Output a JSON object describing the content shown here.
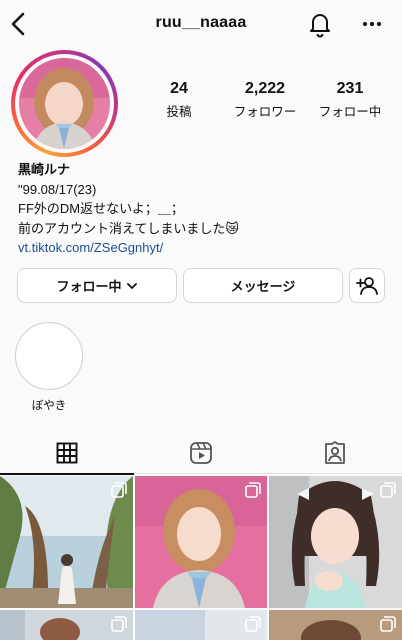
{
  "header": {
    "username": "ruu__naaaa",
    "back_icon": "chevron-left-icon",
    "bell_icon": "bell-icon",
    "more_icon": "more-dots-icon"
  },
  "stats": [
    {
      "value": "24",
      "label": "投稿"
    },
    {
      "value": "2,222",
      "label": "フォロワー"
    },
    {
      "value": "231",
      "label": "フォロー中"
    }
  ],
  "bio": {
    "name": "黒崎ルナ",
    "line1": "\"99.08/17(23)",
    "line2": "FF外のDM返せないよ；＿；",
    "line3": "前のアカウント消えてしまいました😿",
    "link": "vt.tiktok.com/ZSeGgnhyt/"
  },
  "actions": {
    "following_label": "フォロー中",
    "message_label": "メッセージ",
    "suggest_icon": "add-person-icon"
  },
  "highlights": [
    {
      "label": "ぼやき"
    }
  ],
  "tabs": [
    {
      "icon": "grid-icon",
      "active": true
    },
    {
      "icon": "reels-icon",
      "active": false
    },
    {
      "icon": "tagged-person-icon",
      "active": false
    }
  ],
  "colors": {
    "link": "#1e4d94",
    "ring_start": "#f9a43b",
    "ring_end": "#c13584"
  }
}
